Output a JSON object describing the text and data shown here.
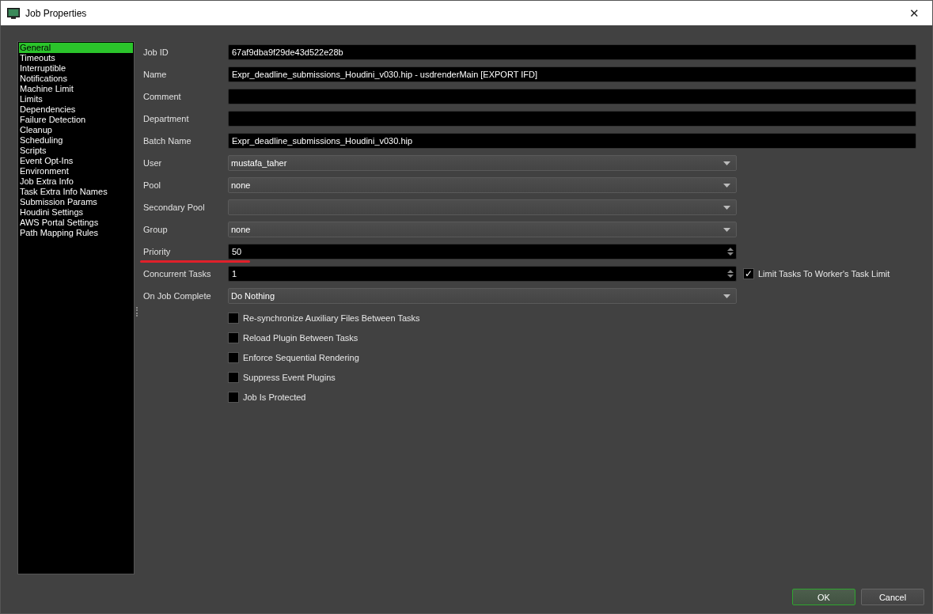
{
  "window": {
    "title": "Job Properties",
    "close": "✕"
  },
  "sidebar": {
    "items": [
      {
        "label": "General",
        "selected": true
      },
      {
        "label": "Timeouts",
        "selected": false
      },
      {
        "label": "Interruptible",
        "selected": false
      },
      {
        "label": "Notifications",
        "selected": false
      },
      {
        "label": "Machine Limit",
        "selected": false
      },
      {
        "label": "Limits",
        "selected": false
      },
      {
        "label": "Dependencies",
        "selected": false
      },
      {
        "label": "Failure Detection",
        "selected": false
      },
      {
        "label": "Cleanup",
        "selected": false
      },
      {
        "label": "Scheduling",
        "selected": false
      },
      {
        "label": "Scripts",
        "selected": false
      },
      {
        "label": "Event Opt-Ins",
        "selected": false
      },
      {
        "label": "Environment",
        "selected": false
      },
      {
        "label": "Job Extra Info",
        "selected": false
      },
      {
        "label": "Task Extra Info Names",
        "selected": false
      },
      {
        "label": "Submission Params",
        "selected": false
      },
      {
        "label": "Houdini Settings",
        "selected": false
      },
      {
        "label": "AWS Portal Settings",
        "selected": false
      },
      {
        "label": "Path Mapping Rules",
        "selected": false
      }
    ]
  },
  "fields": [
    {
      "kind": "text",
      "label": "Job ID",
      "value": "67af9dba9f29de43d522e28b"
    },
    {
      "kind": "text",
      "label": "Name",
      "value": "Expr_deadline_submissions_Houdini_v030.hip - usdrenderMain [EXPORT IFD]"
    },
    {
      "kind": "text",
      "label": "Comment"
    },
    {
      "kind": "text",
      "label": "Department"
    },
    {
      "kind": "text",
      "label": "Batch Name",
      "value": "Expr_deadline_submissions_Houdini_v030.hip"
    },
    {
      "kind": "dropdown",
      "label": "User",
      "value": "mustafa_taher"
    },
    {
      "kind": "dropdown",
      "label": "Pool",
      "value": "none"
    },
    {
      "kind": "dropdown",
      "label": "Secondary Pool"
    },
    {
      "kind": "dropdown",
      "label": "Group",
      "value": "none"
    },
    {
      "kind": "spin",
      "label": "Priority",
      "value": "50",
      "underlined": true
    },
    {
      "kind": "spin",
      "label": "Concurrent Tasks",
      "value": "1",
      "option": {
        "label": "Limit Tasks To Worker's Task Limit",
        "checked": true,
        "tick": "✓"
      }
    },
    {
      "kind": "dropdown",
      "label": "On Job Complete",
      "value": "Do Nothing"
    }
  ],
  "checkboxes": [
    {
      "label": "Re-synchronize Auxiliary Files Between Tasks",
      "checked": false
    },
    {
      "label": "Reload Plugin Between Tasks",
      "checked": false
    },
    {
      "label": "Enforce Sequential Rendering",
      "checked": false
    },
    {
      "label": "Suppress Event Plugins",
      "checked": false
    },
    {
      "label": "Job Is Protected",
      "checked": false
    }
  ],
  "buttons": [
    {
      "label": "OK",
      "default": true
    },
    {
      "label": "Cancel",
      "default": false
    }
  ]
}
